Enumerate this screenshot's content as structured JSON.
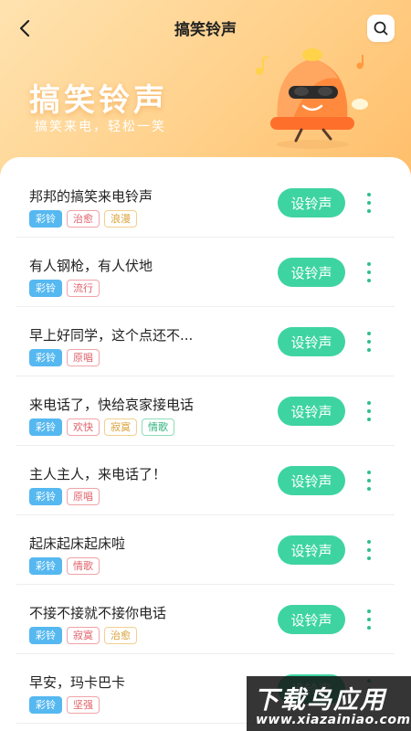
{
  "header": {
    "title": "搞笑铃声",
    "hero_title": "搞笑铃声",
    "hero_subtitle": "搞笑来电，轻松一笑",
    "back_icon": "chevron-left-icon",
    "search_icon": "search-icon"
  },
  "colors": {
    "accent": "#3ed4a1",
    "cailing_tag": "#56b8f0",
    "header_gradient_start": "#ffe3b0",
    "header_gradient_end": "#ffbe6a"
  },
  "ringtones": [
    {
      "title": "邦邦的搞笑来电铃声",
      "button": "设铃声",
      "tags": [
        {
          "label": "彩铃",
          "style": "cailing"
        },
        {
          "label": "治愈",
          "style": "red"
        },
        {
          "label": "浪漫",
          "style": "yellow"
        }
      ]
    },
    {
      "title": "有人钢枪，有人伏地",
      "button": "设铃声",
      "tags": [
        {
          "label": "彩铃",
          "style": "cailing"
        },
        {
          "label": "流行",
          "style": "red"
        }
      ]
    },
    {
      "title": "早上好同学，这个点还不...",
      "button": "设铃声",
      "tags": [
        {
          "label": "彩铃",
          "style": "cailing"
        },
        {
          "label": "原唱",
          "style": "red"
        }
      ]
    },
    {
      "title": "来电话了，快给哀家接电话",
      "button": "设铃声",
      "tags": [
        {
          "label": "彩铃",
          "style": "cailing"
        },
        {
          "label": "欢快",
          "style": "red"
        },
        {
          "label": "寂寞",
          "style": "yellow"
        },
        {
          "label": "情歌",
          "style": "green"
        }
      ]
    },
    {
      "title": "主人主人，来电话了！",
      "button": "设铃声",
      "tags": [
        {
          "label": "彩铃",
          "style": "cailing"
        },
        {
          "label": "原唱",
          "style": "red"
        }
      ]
    },
    {
      "title": "起床起床起床啦",
      "button": "设铃声",
      "tags": [
        {
          "label": "彩铃",
          "style": "cailing"
        },
        {
          "label": "情歌",
          "style": "red"
        }
      ]
    },
    {
      "title": "不接不接就不接你电话",
      "button": "设铃声",
      "tags": [
        {
          "label": "彩铃",
          "style": "cailing"
        },
        {
          "label": "寂寞",
          "style": "red"
        },
        {
          "label": "治愈",
          "style": "yellow"
        }
      ]
    },
    {
      "title": "早安，玛卡巴卡",
      "button": "设铃声",
      "tags": [
        {
          "label": "彩铃",
          "style": "cailing"
        },
        {
          "label": "坚强",
          "style": "red"
        }
      ]
    }
  ],
  "more_icon": "more-vertical-icon",
  "watermark": {
    "main": "下载鸟应用",
    "url": "www.xiazainiao.com"
  }
}
